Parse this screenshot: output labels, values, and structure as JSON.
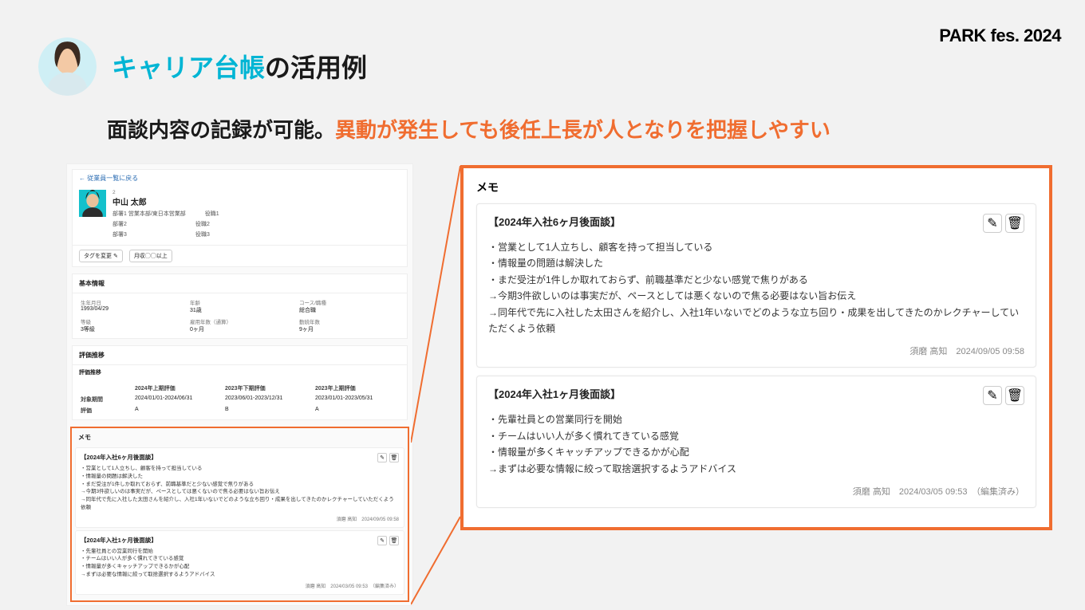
{
  "brand": "PARK fes. 2024",
  "title_accent": "キャリア台帳",
  "title_rest": "の活用例",
  "subtitle_plain": "面談内容の記録が可能。",
  "subtitle_accent": "異動が発生しても後任上長が人となりを把握しやすい",
  "left": {
    "back": "← 従業員一覧に戻る",
    "id": "2",
    "name": "中山 太郎",
    "dept_label": "部署1",
    "dept": "営業本部/東日本営業部",
    "dept2": "部署2",
    "dept3": "部署3",
    "role1": "役職1",
    "role2": "役職2",
    "role3": "役職3",
    "tag_change": "タグを変更 ✎",
    "tag1": "月収◯◯以上",
    "basic_title": "基本情報",
    "bi": {
      "dob_l": "生年月日",
      "dob": "1993/04/29",
      "age_l": "年齢",
      "age": "31歳",
      "course_l": "コース/職種",
      "course": "総合職",
      "grade_l": "等級",
      "grade": "3等級",
      "emp_l": "雇用年数（通算）",
      "emp": "0ヶ月",
      "tenure_l": "勤続年数",
      "tenure": "9ヶ月"
    },
    "eval_title": "評価推移",
    "eval_sub": "評価推移",
    "ev": {
      "c1": "2024年上期評価",
      "c2": "2023年下期評価",
      "c3": "2023年上期評価",
      "r1l": "対象期間",
      "r1a": "2024/01/01-2024/06/31",
      "r1b": "2023/06/01-2023/12/31",
      "r1c": "2023/01/01-2023/05/31",
      "r2l": "評価",
      "r2a": "A",
      "r2b": "B",
      "r2c": "A"
    },
    "memo_title": "メモ",
    "m1": {
      "h": "【2024年入社6ヶ月後面談】",
      "b": "・営業として1人立ちし、顧客を持って担当している\n・情報量の問題は解決した\n・まだ受注が1件しか取れておらず、前職基準だと少ない感覚で焦りがある\n→今期3件欲しいのは事実だが、ペースとしては悪くないので焦る必要はない旨お伝え\n→同年代で先に入社した太田さんを紹介し、入社1年いないでどのような立ち回り・成果を出してきたのかレクチャーしていただくよう依頼",
      "f": "須磨 高知　2024/09/05 09:58"
    },
    "m2": {
      "h": "【2024年入社1ヶ月後面談】",
      "b": "・先輩社員との営業同行を開始\n・チームはいい人が多く慣れてきている感覚\n・情報量が多くキャッチアップできるかが心配\n→まずは必要な情報に絞って取捨選択するようアドバイス",
      "f": "須磨 高知　2024/03/05 09:53　（編集済み）"
    }
  },
  "right": {
    "title": "メモ",
    "m1": {
      "h": "【2024年入社6ヶ月後面談】",
      "b": "・営業として1人立ちし、顧客を持って担当している\n・情報量の問題は解決した\n・まだ受注が1件しか取れておらず、前職基準だと少ない感覚で焦りがある\n→今期3件欲しいのは事実だが、ペースとしては悪くないので焦る必要はない旨お伝え\n→同年代で先に入社した太田さんを紹介し、入社1年いないでどのような立ち回り・成果を出してきたのかレクチャーしていただくよう依頼",
      "f": "須磨 高知　2024/09/05 09:58"
    },
    "m2": {
      "h": "【2024年入社1ヶ月後面談】",
      "b": "・先輩社員との営業同行を開始\n・チームはいい人が多く慣れてきている感覚\n・情報量が多くキャッチアップできるかが心配\n→まずは必要な情報に絞って取捨選択するようアドバイス",
      "f": "須磨 高知　2024/03/05 09:53　（編集済み）"
    }
  },
  "icons": {
    "edit": "✎",
    "delete": "🗑"
  }
}
